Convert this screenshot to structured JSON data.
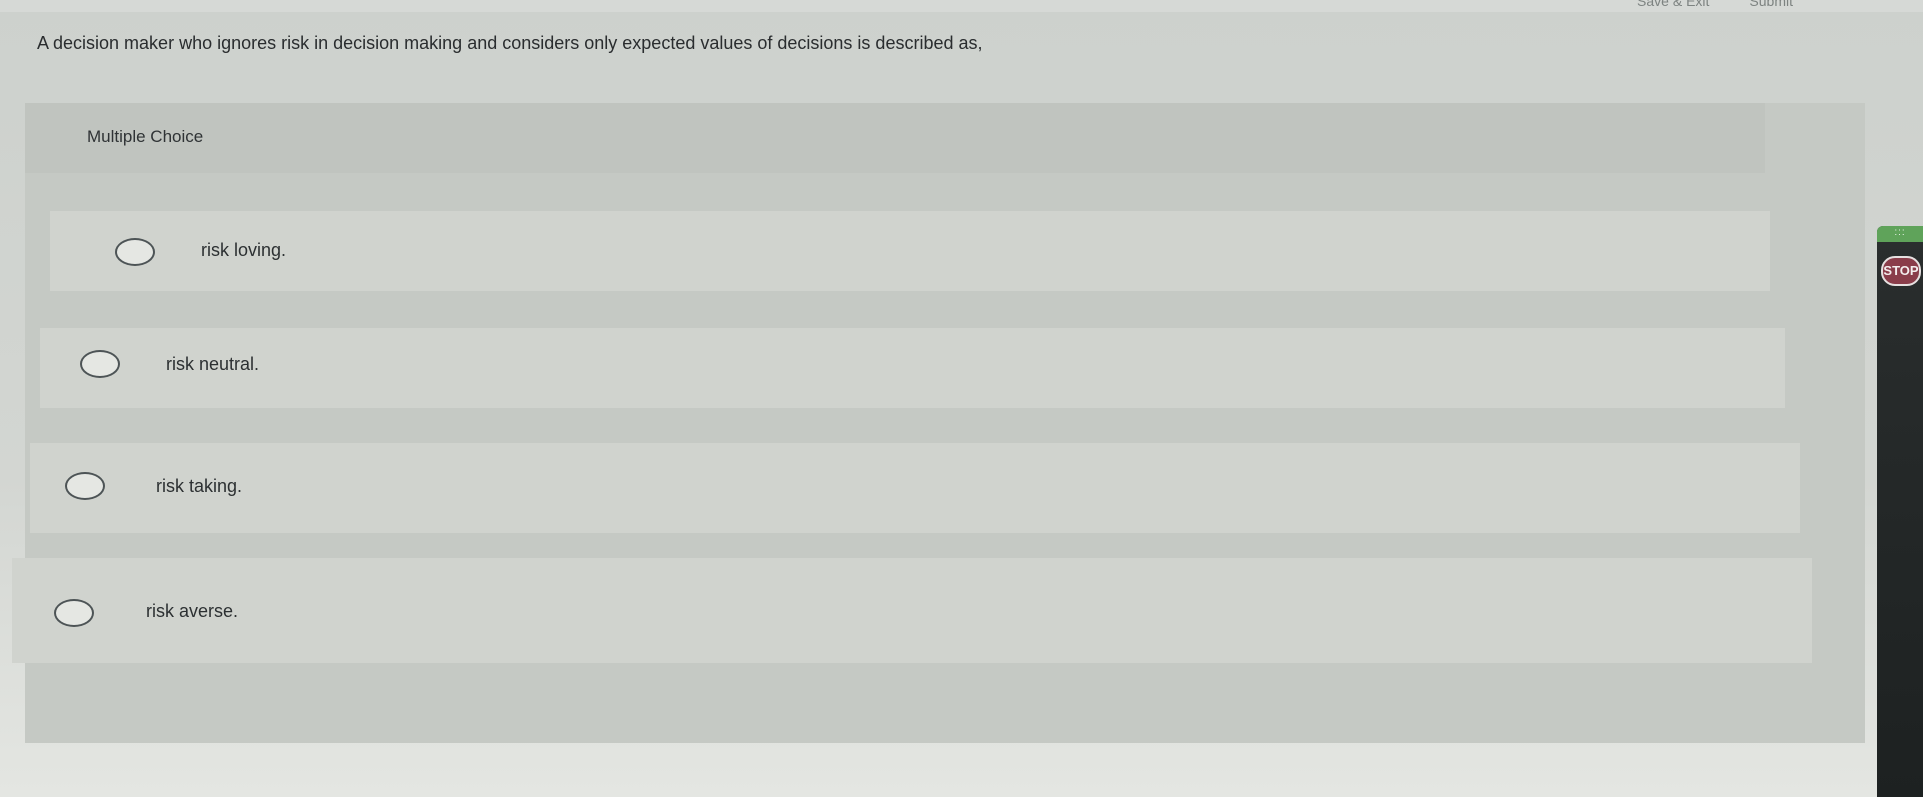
{
  "top_bar": {
    "links": [
      "Save & Exit",
      "Submit"
    ]
  },
  "question": {
    "text": "A decision maker who ignores risk in decision making and considers only expected values of decisions is described as,"
  },
  "panel": {
    "label": "Multiple Choice"
  },
  "options": [
    {
      "label": "risk loving."
    },
    {
      "label": "risk neutral."
    },
    {
      "label": "risk taking."
    },
    {
      "label": "risk averse."
    }
  ],
  "toolbar": {
    "grip": ":::",
    "stop_label": "STOP"
  },
  "colors": {
    "stop_button": "#8a3d4a",
    "toolbar_accent": "#5fa35a"
  }
}
